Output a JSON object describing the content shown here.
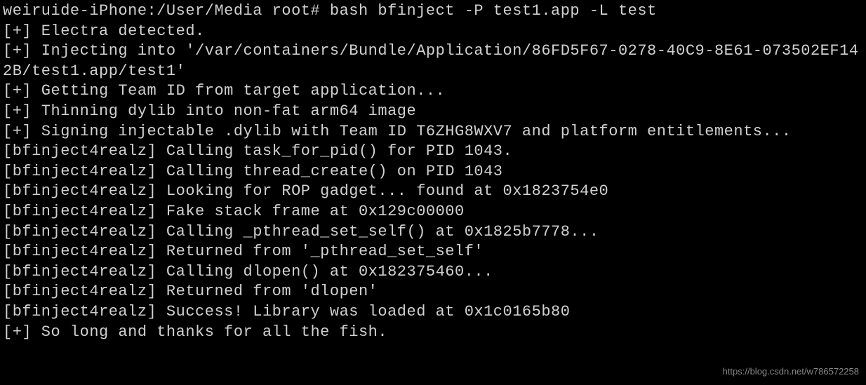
{
  "terminal": {
    "lines": [
      "weiruide-iPhone:/User/Media root# bash bfinject -P test1.app -L test",
      "[+] Electra detected.",
      "[+] Injecting into '/var/containers/Bundle/Application/86FD5F67-0278-40C9-8E61-073502EF142B/test1.app/test1'",
      "[+] Getting Team ID from target application...",
      "[+] Thinning dylib into non-fat arm64 image",
      "[+] Signing injectable .dylib with Team ID T6ZHG8WXV7 and platform entitlements...",
      "[bfinject4realz] Calling task_for_pid() for PID 1043.",
      "[bfinject4realz] Calling thread_create() on PID 1043",
      "[bfinject4realz] Looking for ROP gadget... found at 0x1823754e0",
      "[bfinject4realz] Fake stack frame at 0x129c00000",
      "[bfinject4realz] Calling _pthread_set_self() at 0x1825b7778...",
      "[bfinject4realz] Returned from '_pthread_set_self'",
      "[bfinject4realz] Calling dlopen() at 0x182375460...",
      "[bfinject4realz] Returned from 'dlopen'",
      "[bfinject4realz] Success! Library was loaded at 0x1c0165b80",
      "[+] So long and thanks for all the fish."
    ]
  },
  "watermark": "https://blog.csdn.net/w786572258"
}
